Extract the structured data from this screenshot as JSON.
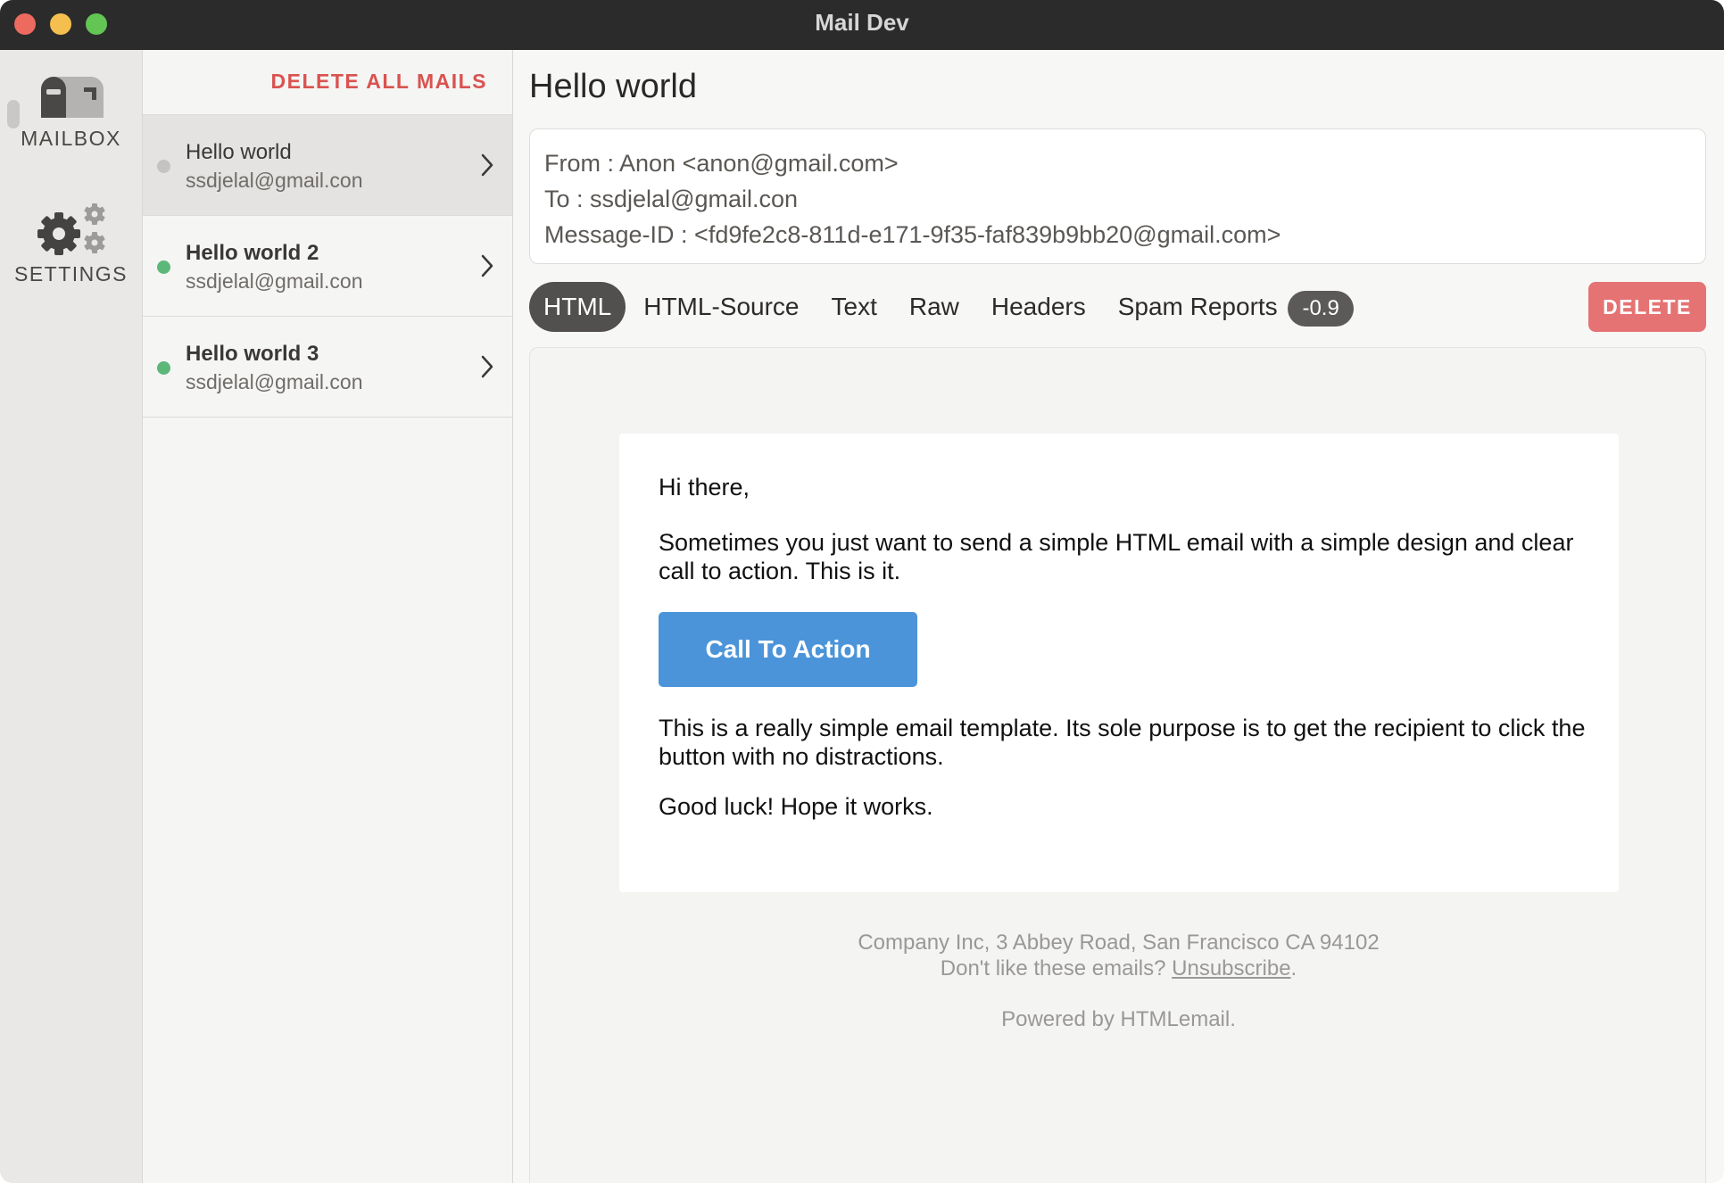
{
  "window": {
    "title": "Mail Dev"
  },
  "nav": {
    "mailbox_label": "MAILBOX",
    "settings_label": "SETTINGS"
  },
  "mail_list": {
    "delete_all_label": "DELETE ALL MAILS",
    "items": [
      {
        "subject": "Hello world",
        "sender": "ssdjelal@gmail.con",
        "unread": false,
        "selected": true
      },
      {
        "subject": "Hello world 2",
        "sender": "ssdjelal@gmail.con",
        "unread": true,
        "selected": false
      },
      {
        "subject": "Hello world 3",
        "sender": "ssdjelal@gmail.con",
        "unread": true,
        "selected": false
      }
    ]
  },
  "detail": {
    "subject": "Hello world",
    "from_line": "From : Anon <anon@gmail.com>",
    "to_line": "To : ssdjelal@gmail.con",
    "message_id_line": "Message-ID : <fd9fe2c8-811d-e171-9f35-faf839b9bb20@gmail.com>",
    "tabs": [
      {
        "label": "HTML",
        "active": true
      },
      {
        "label": "HTML-Source",
        "active": false
      },
      {
        "label": "Text",
        "active": false
      },
      {
        "label": "Raw",
        "active": false
      },
      {
        "label": "Headers",
        "active": false
      },
      {
        "label": "Spam Reports",
        "active": false
      }
    ],
    "spam_score": "-0.9",
    "delete_label": "DELETE"
  },
  "email": {
    "greeting": "Hi there,",
    "paragraph1": "Sometimes you just want to send a simple HTML email with a simple design and clear call to action. This is it.",
    "cta_label": "Call To Action",
    "paragraph2": "This is a really simple email template. Its sole purpose is to get the recipient to click the button with no distractions.",
    "paragraph3": "Good luck! Hope it works.",
    "footer_address": "Company Inc, 3 Abbey Road, San Francisco CA 94102",
    "footer_unsub_prefix": "Don't like these emails? ",
    "footer_unsub_link": "Unsubscribe",
    "footer_unsub_suffix": ".",
    "footer_powered": "Powered by HTMLemail."
  },
  "colors": {
    "unread_dot": "#5cb879",
    "read_dot": "#c4c3c1",
    "danger": "#d9534f",
    "delete_button": "#e57373",
    "cta": "#4b94d9"
  },
  "icons": {
    "mailbox": "mailbox-icon",
    "settings": "gears-icon",
    "chevron": "chevron-right-icon"
  }
}
